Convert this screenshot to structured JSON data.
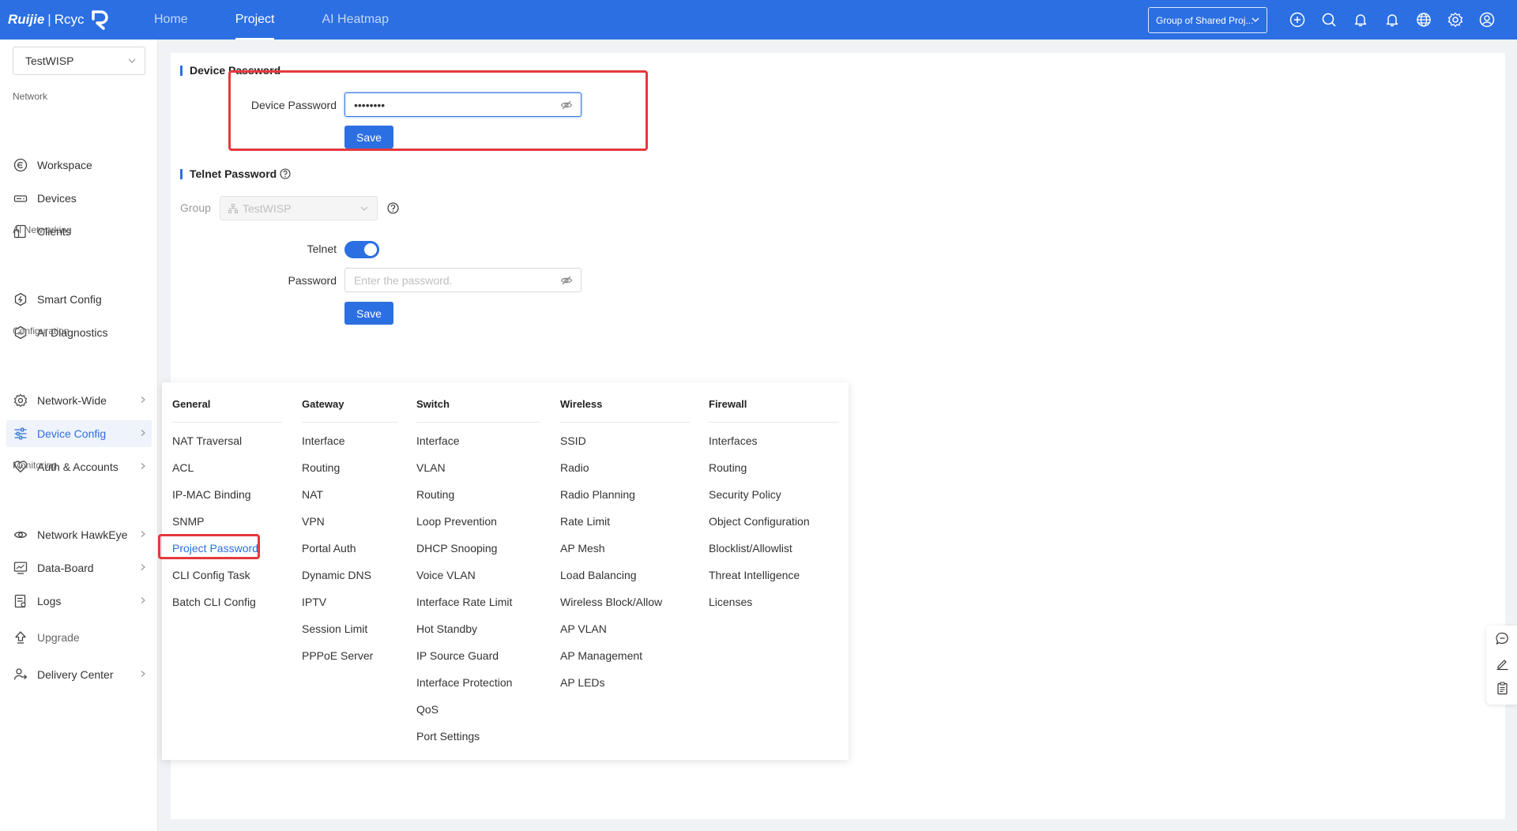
{
  "brand": {
    "name": "Ruijie",
    "separator": "|",
    "sub": "Rcyc"
  },
  "nav": {
    "tabs": [
      "Home",
      "Project",
      "AI Heatmap"
    ],
    "active": 1
  },
  "header": {
    "project_select": "Group of Shared Proj..."
  },
  "sidebar": {
    "tenant": "TestWISP",
    "groups": {
      "network": "Network",
      "ai": "AI Networking",
      "config": "Configuration",
      "monitoring": "Monitoring"
    },
    "items": {
      "workspace": "Workspace",
      "devices": "Devices",
      "clients": "Clients",
      "smart_config": "Smart Config",
      "ai_diagnostics": "AI Diagnostics",
      "network_wide": "Network-Wide",
      "device_config": "Device Config",
      "auth_accounts": "Auth & Accounts",
      "hawkeye": "Network HawkEye",
      "data_board": "Data-Board",
      "logs": "Logs",
      "upgrade": "Upgrade",
      "delivery": "Delivery Center"
    }
  },
  "device_password": {
    "title": "Device Password",
    "label": "Device Password",
    "value": "••••••••",
    "save": "Save"
  },
  "telnet": {
    "title": "Telnet Password",
    "group_label": "Group",
    "group_value": "TestWISP",
    "telnet_label": "Telnet",
    "telnet_enabled": true,
    "password_label": "Password",
    "password_placeholder": "Enter the password.",
    "save": "Save"
  },
  "menu": {
    "general": {
      "title": "General",
      "items": [
        "NAT Traversal",
        "ACL",
        "IP-MAC Binding",
        "SNMP",
        "Project Password",
        "CLI Config Task",
        "Batch CLI Config"
      ]
    },
    "gateway": {
      "title": "Gateway",
      "items": [
        "Interface",
        "Routing",
        "NAT",
        "VPN",
        "Portal Auth",
        "Dynamic DNS",
        "IPTV",
        "Session Limit",
        "PPPoE Server"
      ]
    },
    "switch": {
      "title": "Switch",
      "items": [
        "Interface",
        "VLAN",
        "Routing",
        "Loop Prevention",
        "DHCP Snooping",
        "Voice VLAN",
        "Interface Rate Limit",
        "Hot Standby",
        "IP Source Guard",
        "Interface Protection",
        "QoS",
        "Port Settings"
      ]
    },
    "wireless": {
      "title": "Wireless",
      "items": [
        "SSID",
        "Radio",
        "Radio Planning",
        "Rate Limit",
        "AP Mesh",
        "Load Balancing",
        "Wireless Block/Allow",
        "AP VLAN",
        "AP Management",
        "AP LEDs"
      ]
    },
    "firewall": {
      "title": "Firewall",
      "items": [
        "Interfaces",
        "Routing",
        "Security Policy",
        "Object Configuration",
        "Blocklist/Allowlist",
        "Threat Intelligence",
        "Licenses"
      ]
    }
  }
}
